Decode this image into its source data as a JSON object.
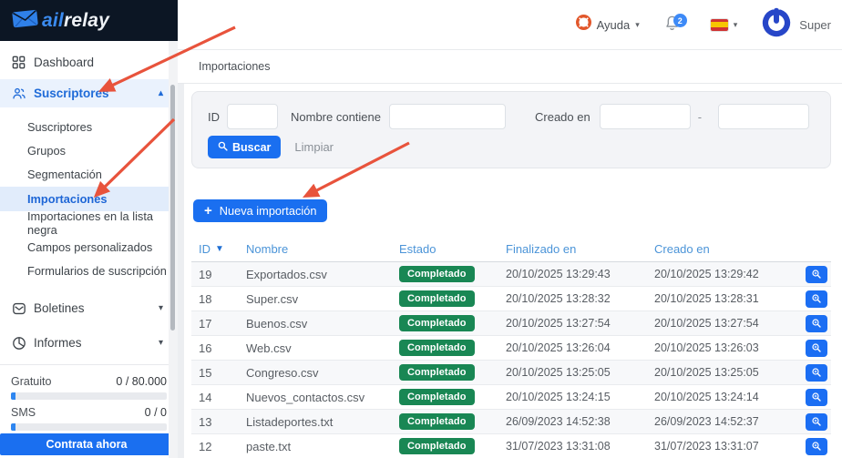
{
  "brand": {
    "logo_prefix": "ail",
    "logo_suffix": "relay"
  },
  "topbar": {
    "help_label": "Ayuda",
    "notification_count": "2",
    "username": "Super"
  },
  "sidebar": {
    "items": [
      {
        "label": "Dashboard"
      },
      {
        "label": "Suscriptores"
      },
      {
        "label": "Boletines"
      },
      {
        "label": "Informes"
      }
    ],
    "sub_items": [
      {
        "label": "Suscriptores",
        "active": false
      },
      {
        "label": "Grupos",
        "active": false
      },
      {
        "label": "Segmentación",
        "active": false
      },
      {
        "label": "Importaciones",
        "active": true
      },
      {
        "label": "Importaciones en la lista negra",
        "active": false
      },
      {
        "label": "Campos personalizados",
        "active": false
      },
      {
        "label": "Formularios de suscripción",
        "active": false
      }
    ],
    "usage": [
      {
        "label": "Gratuito",
        "value": "0 / 80.000"
      },
      {
        "label": "SMS",
        "value": "0 / 0"
      }
    ],
    "cta_label": "Contrata ahora"
  },
  "breadcrumb": "Importaciones",
  "filters": {
    "id_label": "ID",
    "id_value": "",
    "name_label": "Nombre contiene",
    "name_value": "",
    "created_label": "Creado en",
    "created_from_value": "",
    "created_to_value": "",
    "range_separator": "-",
    "search_label": "Buscar",
    "clear_label": "Limpiar"
  },
  "actions": {
    "new_import_label": "Nueva importación"
  },
  "table": {
    "columns": [
      "ID",
      "Nombre",
      "Estado",
      "Finalizado en",
      "Creado en"
    ],
    "sorted_column": "ID",
    "sort_direction": "desc",
    "rows": [
      {
        "id": "19",
        "nombre": "Exportados.csv",
        "estado": "Completado",
        "finalizado_en": "20/10/2025 13:29:43",
        "creado_en": "20/10/2025 13:29:42"
      },
      {
        "id": "18",
        "nombre": "Super.csv",
        "estado": "Completado",
        "finalizado_en": "20/10/2025 13:28:32",
        "creado_en": "20/10/2025 13:28:31"
      },
      {
        "id": "17",
        "nombre": "Buenos.csv",
        "estado": "Completado",
        "finalizado_en": "20/10/2025 13:27:54",
        "creado_en": "20/10/2025 13:27:54"
      },
      {
        "id": "16",
        "nombre": "Web.csv",
        "estado": "Completado",
        "finalizado_en": "20/10/2025 13:26:04",
        "creado_en": "20/10/2025 13:26:03"
      },
      {
        "id": "15",
        "nombre": "Congreso.csv",
        "estado": "Completado",
        "finalizado_en": "20/10/2025 13:25:05",
        "creado_en": "20/10/2025 13:25:05"
      },
      {
        "id": "14",
        "nombre": "Nuevos_contactos.csv",
        "estado": "Completado",
        "finalizado_en": "20/10/2025 13:24:15",
        "creado_en": "20/10/2025 13:24:14"
      },
      {
        "id": "13",
        "nombre": "Listadeportes.txt",
        "estado": "Completado",
        "finalizado_en": "26/09/2023 14:52:38",
        "creado_en": "26/09/2023 14:52:37"
      },
      {
        "id": "12",
        "nombre": "paste.txt",
        "estado": "Completado",
        "finalizado_en": "31/07/2023 13:31:08",
        "creado_en": "31/07/2023 13:31:07"
      }
    ]
  },
  "colors": {
    "accent_blue": "#1a6ff0",
    "badge_green": "#198754",
    "arrow_red": "#e8533c",
    "table_header_blue": "#4b94d8",
    "brand_navy": "#0c1624",
    "help_icon_orange": "#e2572b"
  }
}
